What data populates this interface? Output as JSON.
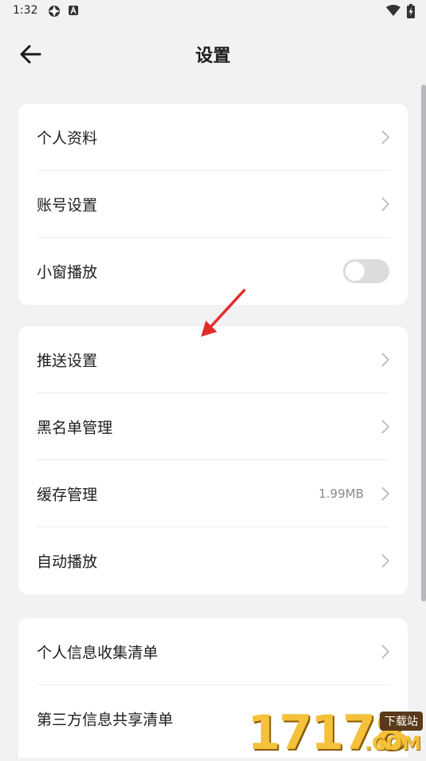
{
  "status_bar": {
    "time": "1:32"
  },
  "header": {
    "title": "设置"
  },
  "groups": [
    {
      "items": [
        {
          "label": "个人资料"
        },
        {
          "label": "账号设置"
        },
        {
          "label": "小窗播放",
          "toggle": false
        }
      ]
    },
    {
      "items": [
        {
          "label": "推送设置"
        },
        {
          "label": "黑名单管理"
        },
        {
          "label": "缓存管理",
          "value": "1.99MB"
        },
        {
          "label": "自动播放"
        }
      ]
    },
    {
      "items": [
        {
          "label": "个人信息收集清单"
        },
        {
          "label": "第三方信息共享清单"
        }
      ]
    }
  ],
  "watermark": {
    "digits": "17178",
    "badge": "下载站",
    "domain": ".COM"
  },
  "colors": {
    "background": "#f2f2f4",
    "card": "#ffffff",
    "arrow": "#e32b2b",
    "toggle_off": "#dcdcde"
  }
}
